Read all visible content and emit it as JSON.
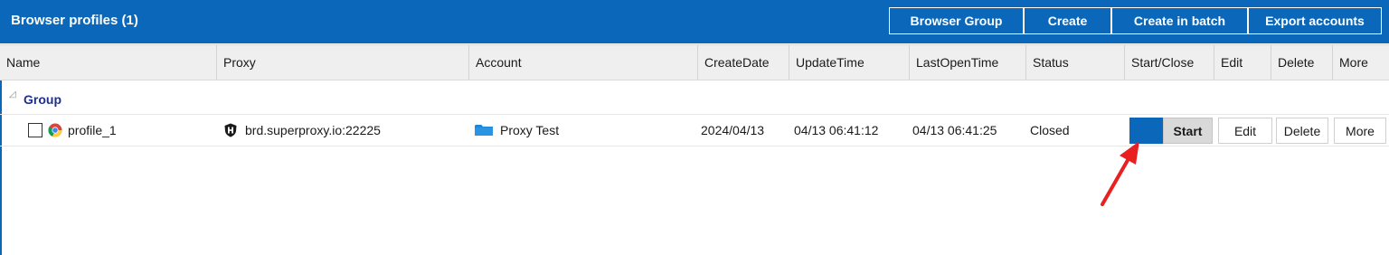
{
  "titlebar": {
    "title": "Browser profiles (1)",
    "buttons": [
      "Browser Group",
      "Create",
      "Create in batch",
      "Export accounts"
    ]
  },
  "columns": [
    "Name",
    "Proxy",
    "Account",
    "CreateDate",
    "UpdateTime",
    "LastOpenTime",
    "Status",
    "Start/Close",
    "Edit",
    "Delete",
    "More"
  ],
  "group": {
    "label": "Group"
  },
  "rows": [
    {
      "name": "profile_1",
      "proxy": "brd.superproxy.io:22225",
      "account": "Proxy Test",
      "create_date": "2024/04/13",
      "update_time": "04/13 06:41:12",
      "last_open_time": "04/13 06:41:25",
      "status": "Closed",
      "start_label": "Start",
      "edit_label": "Edit",
      "delete_label": "Delete",
      "more_label": "More"
    }
  ],
  "colors": {
    "accent": "#0a67b9",
    "group_text": "#1f2f8c",
    "annotation": "#e8201f"
  },
  "icons": {
    "browser": "chrome-icon",
    "proxy": "shield-icon",
    "account": "folder-icon",
    "group_toggle": "triangle-collapse-icon",
    "annotation": "red-arrow-icon"
  }
}
